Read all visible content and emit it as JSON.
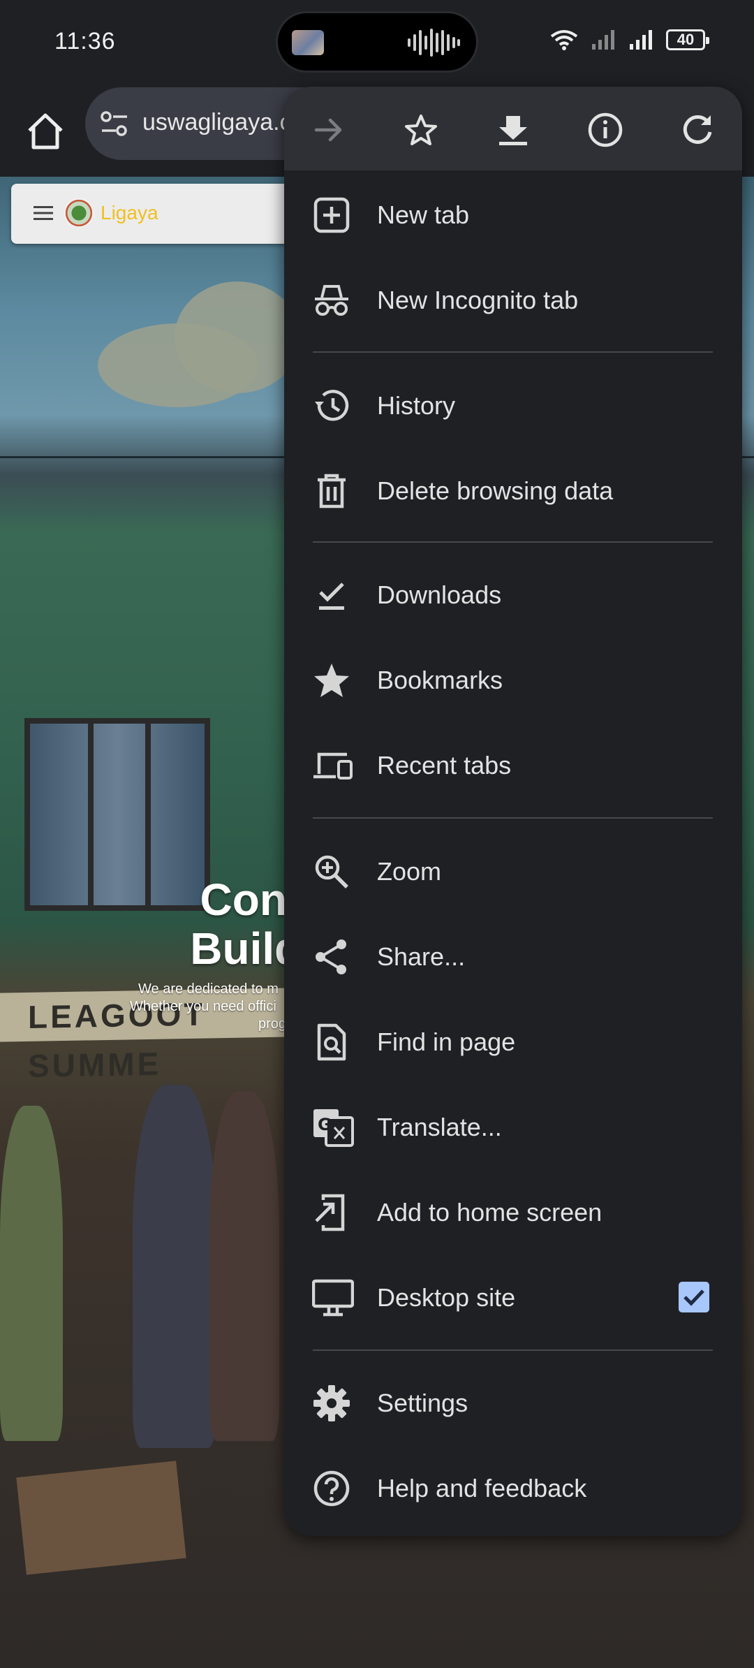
{
  "status_bar": {
    "time": "11:36",
    "battery": "40",
    "icons": [
      "media-thumbnail-icon",
      "audio-wave-icon",
      "wifi-icon",
      "signal-icon",
      "signal-icon",
      "battery-icon"
    ]
  },
  "toolbar": {
    "url": "uswagligaya.c"
  },
  "page": {
    "brand": "Ligaya",
    "hero_title_lines": [
      "Conn",
      "Buildi"
    ],
    "hero_text_lines": [
      "We are dedicated to m",
      "Whether you need offici",
      "prog"
    ],
    "sign_text": "LEAGOOT SUMME"
  },
  "menu": {
    "top_actions": [
      {
        "name": "forward-icon",
        "enabled": false
      },
      {
        "name": "bookmark-star-icon",
        "enabled": true
      },
      {
        "name": "download-icon",
        "enabled": true
      },
      {
        "name": "info-icon",
        "enabled": true
      },
      {
        "name": "refresh-icon",
        "enabled": true
      }
    ],
    "items": [
      {
        "label": "New tab",
        "icon": "new-tab-icon"
      },
      {
        "label": "New Incognito tab",
        "icon": "incognito-icon"
      },
      {
        "label": "History",
        "icon": "history-icon"
      },
      {
        "label": "Delete browsing data",
        "icon": "trash-icon"
      },
      {
        "label": "Downloads",
        "icon": "downloads-check-icon"
      },
      {
        "label": "Bookmarks",
        "icon": "star-icon"
      },
      {
        "label": "Recent tabs",
        "icon": "devices-icon"
      },
      {
        "label": "Zoom",
        "icon": "zoom-icon"
      },
      {
        "label": "Share...",
        "icon": "share-icon"
      },
      {
        "label": "Find in page",
        "icon": "find-in-page-icon"
      },
      {
        "label": "Translate...",
        "icon": "translate-icon"
      },
      {
        "label": "Add to home screen",
        "icon": "add-to-home-icon"
      },
      {
        "label": "Desktop site",
        "icon": "monitor-icon",
        "checked": true
      },
      {
        "label": "Settings",
        "icon": "gear-icon"
      },
      {
        "label": "Help and feedback",
        "icon": "help-icon"
      }
    ]
  },
  "colors": {
    "menu_bg": "#1f2024",
    "menu_top_bg": "#2f3035",
    "text": "#e3e3e3",
    "checkbox": "#a8c7fa",
    "brand": "#f0c020"
  }
}
